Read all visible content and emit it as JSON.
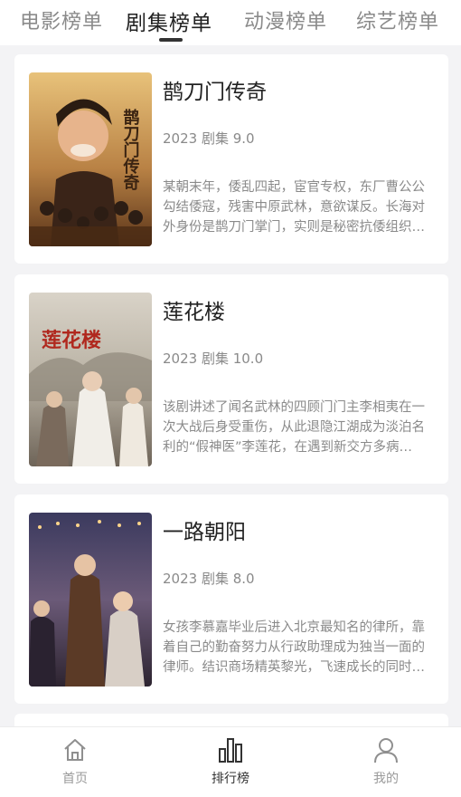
{
  "top_tabs": [
    {
      "label": "电影榜单",
      "active": false
    },
    {
      "label": "剧集榜单",
      "active": true
    },
    {
      "label": "动漫榜单",
      "active": false
    },
    {
      "label": "综艺榜单",
      "active": false
    }
  ],
  "items": [
    {
      "title": "鹊刀门传奇",
      "meta": "2023 剧集 9.0",
      "description": "某朝末年，倭乱四起，宦官专权，东厂曹公公勾结倭寇，残害中原武林，意欲谋反。长海对外身份是鹊刀门掌门，实则是秘密抗倭组织成员，除了剿灭倭…",
      "poster_text": "鹊刀门传奇"
    },
    {
      "title": "莲花楼",
      "meta": "2023 剧集 10.0",
      "description": "该剧讲述了闻名武林的四顾门门主李相夷在一次大战后身受重伤，从此退隐江湖成为淡泊名利的“假神医”李莲花，在遇到新交方多病与旧敌笛飞声后重新…",
      "poster_text": "莲花楼"
    },
    {
      "title": "一路朝阳",
      "meta": "2023 剧集 8.0",
      "description": "女孩李慕嘉毕业后进入北京最知名的律所，靠着自己的勤奋努力从行政助理成为独当一面的律师。结识商场精英黎光，飞速成长的同时两人的感情也几…",
      "poster_text": ""
    }
  ],
  "bottom_nav": [
    {
      "label": "首页",
      "icon": "home-icon",
      "active": false
    },
    {
      "label": "排行榜",
      "icon": "bar-chart-icon",
      "active": true
    },
    {
      "label": "我的",
      "icon": "user-icon",
      "active": false
    }
  ]
}
